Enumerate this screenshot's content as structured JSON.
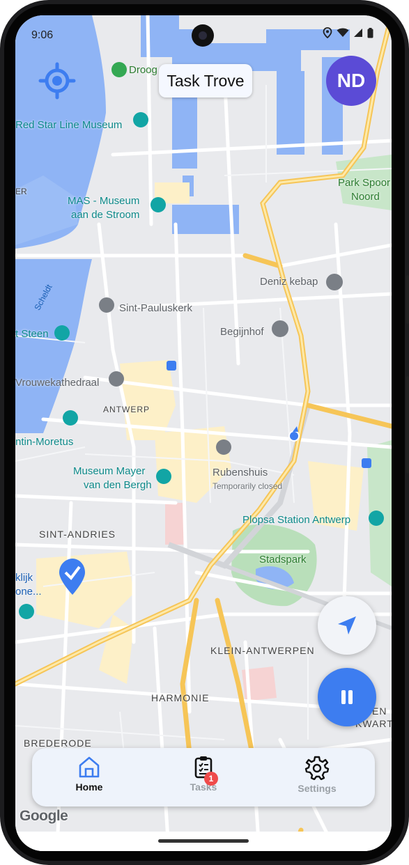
{
  "status_bar": {
    "time": "9:06"
  },
  "header": {
    "title": "Task Trove",
    "avatar_initials": "ND"
  },
  "colors": {
    "accent": "#3d7df0",
    "avatar": "#5b4bd6",
    "badge": "#ef4b4b",
    "water": "#8fb4f5",
    "road": "#f6c557"
  },
  "map": {
    "labels": {
      "droog": "Droog",
      "red_star": "Red Star Line Museum",
      "mas1": "MAS - Museum",
      "mas2": "aan de Stroom",
      "park1": "Park Spoor",
      "park2": "Noord",
      "deniz": "Deniz kebap",
      "sint_paulus": "Sint-Pauluskerk",
      "begijnhof": "Begijnhof",
      "steen": "t Steen",
      "scheldt": "Scheldt",
      "kathedraal": "Vrouwekathedraal",
      "antwerp": "ANTWERP",
      "moretus": "ntin-Moretus",
      "mayer1": "Museum Mayer",
      "mayer2": "van den Bergh",
      "rubens": "Rubenshuis",
      "rubens_status": "Temporarily closed",
      "plopsa": "Plopsa Station Antwerp",
      "sint_andries": "SINT-ANDRIES",
      "stadspark": "Stadspark",
      "klijk": "klijk",
      "one": "one...",
      "klein": "KLEIN-ANTWERPEN",
      "harmonie": "HARMONIE",
      "en": "EN",
      "kwartier": "KWARTIER",
      "brederode": "BREDERODE",
      "er": "ER"
    },
    "attribution": "Google"
  },
  "bottom_nav": {
    "items": [
      {
        "label": "Home",
        "icon": "home-icon",
        "active": true
      },
      {
        "label": "Tasks",
        "icon": "clipboard-icon",
        "badge": "1"
      },
      {
        "label": "Settings",
        "icon": "gear-icon"
      }
    ]
  },
  "icons": {
    "locate": "crosshair-icon",
    "navigate": "navigation-arrow-icon",
    "pause": "pause-icon"
  }
}
